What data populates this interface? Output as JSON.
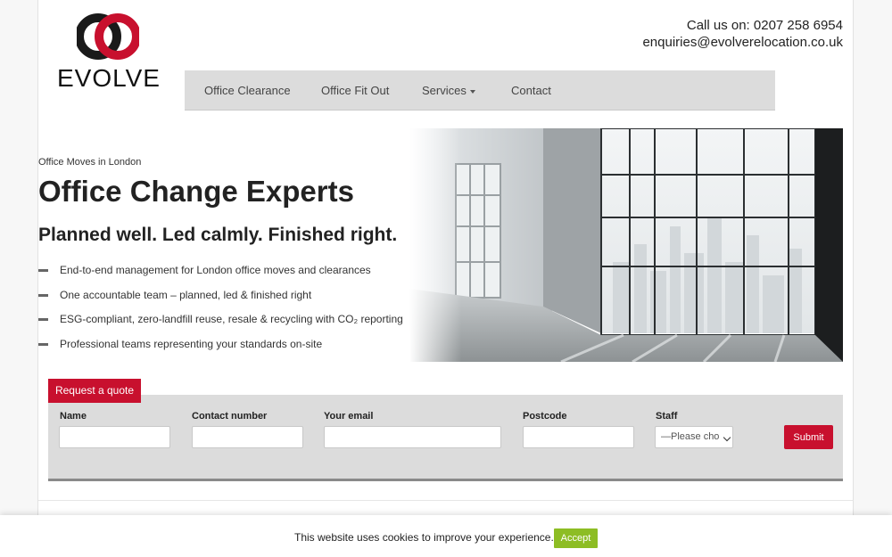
{
  "brand": {
    "name": "EVOLVE",
    "accent_red": "#c8102e",
    "logo_dark": "#222222"
  },
  "header": {
    "phone": "Call us on: 0207 258 6954",
    "email": "enquiries@evolverelocation.co.uk"
  },
  "nav": {
    "items": [
      {
        "label": "Office Clearance"
      },
      {
        "label": "Office Fit Out"
      },
      {
        "label": "Services"
      },
      {
        "label": "Contact"
      }
    ],
    "dropdown_icon": "caret-down-icon"
  },
  "hero": {
    "eyebrow": "Office Moves in London",
    "headline": "Office Change Experts",
    "subhead": "Planned well. Led calmly. Finished right.",
    "bullets": [
      "End-to-end management for London office moves and clearances",
      "One accountable team – planned, led & finished right",
      "ESG-compliant, zero-landfill reuse, resale & recycling with CO₂ reporting",
      "Professional teams representing your standards on-site"
    ]
  },
  "quote_form": {
    "tab_label": "Request a quote",
    "fields": {
      "name": {
        "label": "Name",
        "value": ""
      },
      "contact_number": {
        "label": "Contact number",
        "value": ""
      },
      "email": {
        "label": "Your email",
        "value": ""
      },
      "postcode": {
        "label": "Postcode",
        "value": ""
      },
      "staff": {
        "label": "Staff",
        "selected": "—Please cho"
      }
    },
    "submit_label": "Submit"
  },
  "cookie": {
    "message": "This website uses cookies to improve your experience.",
    "accept_label": "Accept",
    "accept_color": "#8dbd24"
  }
}
